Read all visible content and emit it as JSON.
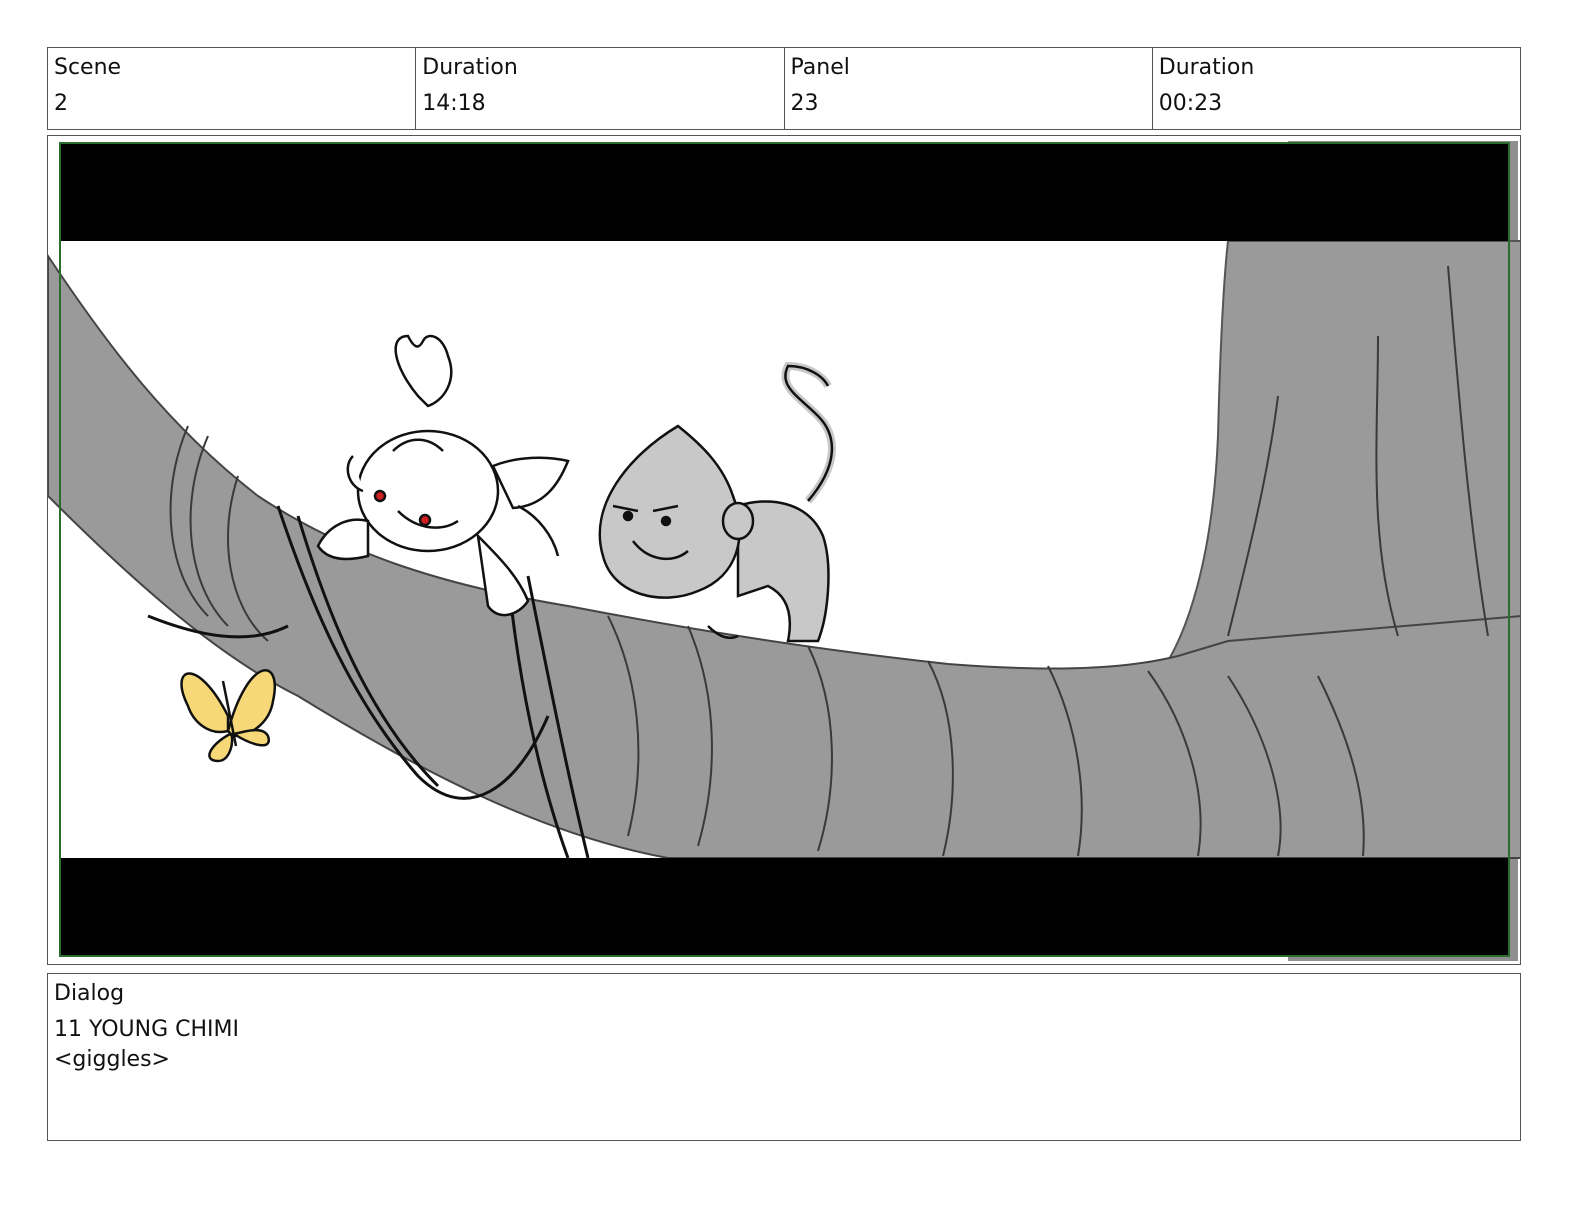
{
  "header": {
    "scene_label": "Scene",
    "scene_value": "2",
    "duration_label": "Duration",
    "duration_value": "14:18",
    "panel_label": "Panel",
    "panel_value": "23",
    "panel_duration_label": "Duration",
    "panel_duration_value": "00:23"
  },
  "dialog": {
    "label": "Dialog",
    "line1": "11 YOUNG CHIMI",
    "line2": "<giggles>"
  },
  "colors": {
    "branch": "#9a9a9a",
    "monkey": "#c8c8c8",
    "butterfly": "#f6d878",
    "letterbox": "#000000",
    "frame_border": "#2e6b2e",
    "eyes": "#d22020"
  }
}
